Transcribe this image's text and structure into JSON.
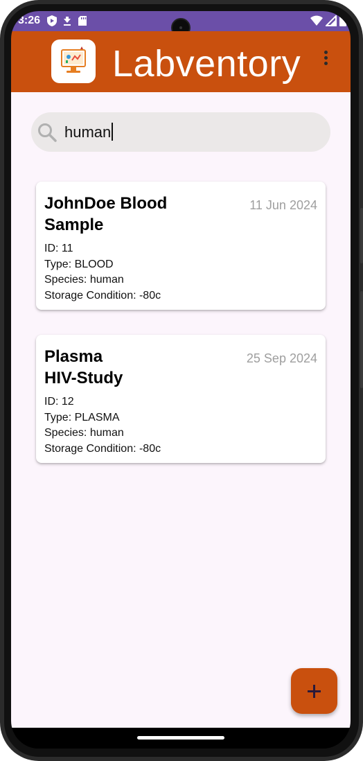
{
  "status_bar": {
    "time": "3:26",
    "icons": [
      "shield-icon",
      "download-icon",
      "sd-card-icon",
      "wifi-icon",
      "signal-icon",
      "battery-icon"
    ]
  },
  "app_bar": {
    "title": "Labventory",
    "logo_icon": "lab-computer-icon",
    "menu_icon": "more-vert-icon",
    "color": "#c9500e"
  },
  "search": {
    "value": "human",
    "icon": "search-icon"
  },
  "samples": [
    {
      "title_line1": "JohnDoe Blood",
      "title_line2": "Sample",
      "date": "11 Jun 2024",
      "id": "ID: 11",
      "type": "Type: BLOOD",
      "species": "Species: human",
      "storage": "Storage Condition: -80c"
    },
    {
      "title_line1": "Plasma",
      "title_line2": "HIV-Study",
      "date": "25 Sep 2024",
      "id": "ID: 12",
      "type": "Type: PLASMA",
      "species": "Species: human",
      "storage": "Storage Condition: -80c"
    }
  ],
  "fab": {
    "icon": "plus-icon"
  },
  "colors": {
    "status_bar": "#6b4fa8",
    "accent": "#c9500e",
    "background": "#fcf5fc",
    "search_bg": "#ebe8e8",
    "date_text": "#9e9e9e"
  }
}
